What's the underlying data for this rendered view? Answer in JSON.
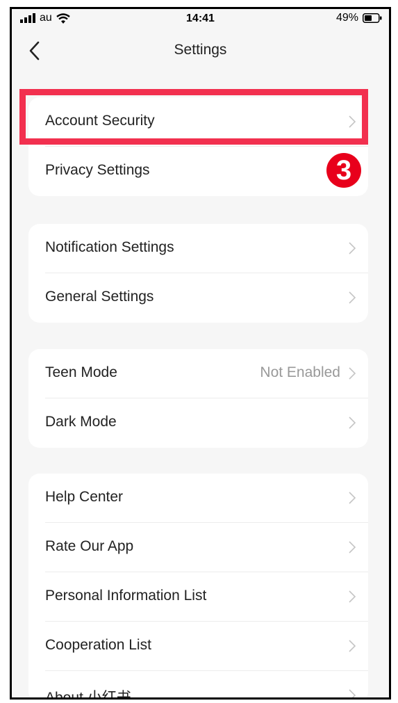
{
  "status_bar": {
    "carrier": "au",
    "time": "14:41",
    "battery": "49%"
  },
  "nav": {
    "title": "Settings"
  },
  "groups": [
    {
      "items": [
        {
          "label": "Account Security",
          "value": ""
        },
        {
          "label": "Privacy Settings",
          "value": ""
        }
      ]
    },
    {
      "items": [
        {
          "label": "Notification Settings",
          "value": ""
        },
        {
          "label": "General Settings",
          "value": ""
        }
      ]
    },
    {
      "items": [
        {
          "label": "Teen Mode",
          "value": "Not Enabled"
        },
        {
          "label": "Dark Mode",
          "value": ""
        }
      ]
    },
    {
      "items": [
        {
          "label": "Help Center",
          "value": ""
        },
        {
          "label": "Rate Our App",
          "value": ""
        },
        {
          "label": "Personal Information List",
          "value": ""
        },
        {
          "label": "Cooperation List",
          "value": ""
        },
        {
          "label": "About 小红书",
          "value": ""
        }
      ]
    }
  ],
  "annotation": {
    "step_number": "3",
    "highlight_color": "#f2304f",
    "badge_color": "#e8001b"
  },
  "icons": {
    "back": "chevron-left-icon",
    "row_arrow": "chevron-right-icon",
    "signal": "signal-bars-icon",
    "wifi": "wifi-icon",
    "battery": "battery-icon"
  }
}
